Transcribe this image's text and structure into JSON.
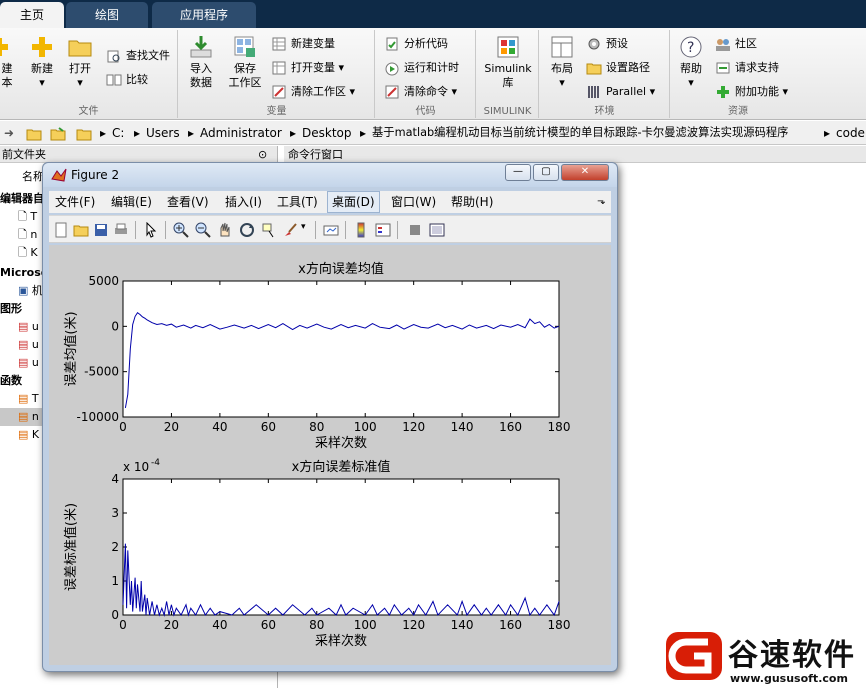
{
  "tabs": [
    "主页",
    "绘图",
    "应用程序"
  ],
  "ribbon": {
    "file": {
      "label": "文件",
      "new_script_l1": "建",
      "new_script_l2": "本",
      "new": "新建",
      "open": "打开",
      "find_files": "查找文件",
      "compare": "比较"
    },
    "variable": {
      "label": "变量",
      "import_l1": "导入",
      "import_l2": "数据",
      "save_l1": "保存",
      "save_l2": "工作区",
      "new_var": "新建变量",
      "open_var": "打开变量",
      "clear_ws": "清除工作区"
    },
    "code": {
      "label": "代码",
      "analyze": "分析代码",
      "run_time": "运行和计时",
      "clear_cmd": "清除命令"
    },
    "simulink": {
      "label": "SIMULINK",
      "btn_l1": "Simulink",
      "btn_l2": "库"
    },
    "env": {
      "label": "环境",
      "layout": "布局",
      "prefs": "预设",
      "set_path": "设置路径",
      "parallel": "Parallel"
    },
    "resources": {
      "label": "资源",
      "help": "帮助",
      "community": "社区",
      "request": "请求支持",
      "addons": "附加功能"
    }
  },
  "address": [
    "C:",
    "Users",
    "Administrator",
    "Desktop",
    "基于matlab编程机动目标当前统计模型的单目标跟踪-卡尔曼滤波算法实现源码程序",
    "code"
  ],
  "left_panel": {
    "title": "前文件夹",
    "col": "名称",
    "groups": [
      "编辑器自",
      "Microso",
      "图形",
      "函数"
    ],
    "items": [
      "T",
      "n",
      "K",
      "机",
      "u",
      "u",
      "u",
      "T",
      "n",
      "K"
    ]
  },
  "cmd_title": "命令行窗口",
  "figure": {
    "title": "Figure 2",
    "menus": [
      "文件(F)",
      "编辑(E)",
      "查看(V)",
      "插入(I)",
      "工具(T)",
      "桌面(D)",
      "窗口(W)",
      "帮助(H)"
    ],
    "selected_menu": "桌面(D)"
  },
  "chart_data": [
    {
      "type": "line",
      "title": "x方向误差均值",
      "xlabel": "采样次数",
      "ylabel": "误差均值(米)",
      "xlim": [
        0,
        180
      ],
      "ylim": [
        -10000,
        5000
      ],
      "xticks": [
        0,
        20,
        40,
        60,
        80,
        100,
        120,
        140,
        160,
        180
      ],
      "yticks": [
        -10000,
        -5000,
        0,
        5000
      ],
      "color": "#0000aa",
      "x": [
        1,
        2,
        3,
        4,
        5,
        6,
        7,
        8,
        9,
        10,
        12,
        14,
        16,
        18,
        20,
        22,
        25,
        28,
        30,
        33,
        36,
        40,
        43,
        46,
        50,
        53,
        56,
        60,
        63,
        66,
        70,
        73,
        76,
        80,
        83,
        86,
        90,
        93,
        96,
        100,
        103,
        106,
        110,
        113,
        116,
        120,
        123,
        126,
        130,
        133,
        136,
        140,
        143,
        146,
        150,
        153,
        156,
        160,
        163,
        166,
        168,
        170,
        172,
        174,
        176,
        178,
        180
      ],
      "y": [
        -9000,
        -7500,
        -2500,
        200,
        1100,
        1500,
        1300,
        1050,
        900,
        700,
        400,
        200,
        300,
        100,
        250,
        -100,
        150,
        -200,
        100,
        -150,
        200,
        -300,
        -100,
        150,
        -200,
        100,
        -250,
        200,
        -150,
        300,
        -350,
        100,
        -200,
        250,
        -100,
        -300,
        200,
        -150,
        100,
        -200,
        300,
        -100,
        -250,
        150,
        -300,
        200,
        -100,
        -200,
        250,
        -150,
        100,
        -300,
        150,
        -200,
        100,
        -250,
        150,
        -100,
        200,
        -150,
        800,
        300,
        500,
        -100,
        200,
        -200,
        0
      ]
    },
    {
      "type": "line",
      "title": "x方向误差标准值",
      "xlabel": "采样次数",
      "ylabel": "误差标准值(米)",
      "exponent_label": "x 10",
      "exponent": "-4",
      "xlim": [
        0,
        180
      ],
      "ylim": [
        0,
        4
      ],
      "xticks": [
        0,
        20,
        40,
        60,
        80,
        100,
        120,
        140,
        160,
        180
      ],
      "yticks": [
        0,
        1,
        2,
        3,
        4
      ],
      "color": "#0000aa",
      "x": [
        0,
        1,
        1.5,
        2,
        3,
        3.5,
        4,
        5,
        5.5,
        6,
        7,
        7.5,
        8,
        9,
        9.5,
        10,
        11,
        12,
        13,
        14,
        15,
        16,
        17,
        18,
        19,
        20,
        21,
        22,
        24,
        26,
        27,
        28,
        30,
        32,
        34,
        36,
        38,
        40,
        45,
        48,
        50,
        55,
        60,
        63,
        66,
        70,
        75,
        78,
        80,
        85,
        88,
        90,
        92,
        95,
        100,
        103,
        105,
        108,
        110,
        112,
        115,
        118,
        120,
        122,
        125,
        128,
        130,
        134,
        138,
        140,
        142,
        145,
        148,
        150,
        152,
        155,
        158,
        160,
        163,
        166,
        168,
        170,
        172,
        175,
        178,
        180
      ],
      "y": [
        0.3,
        2.1,
        0.2,
        1.9,
        0.3,
        1.0,
        0.1,
        1.1,
        0.2,
        0.9,
        0.1,
        1.0,
        0.1,
        0.6,
        0.0,
        0.5,
        0.0,
        0.4,
        0.0,
        0.3,
        0.0,
        0.2,
        0.0,
        0.4,
        0.0,
        0.3,
        0.0,
        0.2,
        0.0,
        0.3,
        0.0,
        0.2,
        0.0,
        0.3,
        0.0,
        0.2,
        0.0,
        0.1,
        0.0,
        0.2,
        0.0,
        0.3,
        0.0,
        0.2,
        0.0,
        0.3,
        0.0,
        0.2,
        0.0,
        0.2,
        0.0,
        0.3,
        0.0,
        0.2,
        0.0,
        0.3,
        0.0,
        0.2,
        0.0,
        0.3,
        0.0,
        0.2,
        0.0,
        0.3,
        0.0,
        0.4,
        0.0,
        0.3,
        0.0,
        0.4,
        0.0,
        0.3,
        0.0,
        0.2,
        0.0,
        0.3,
        0.0,
        0.3,
        0.0,
        0.5,
        0.0,
        0.2,
        0.0,
        0.3,
        0.0,
        0.4
      ]
    }
  ],
  "watermark": {
    "text": "谷速软件",
    "url": "www.gususoft.com"
  }
}
